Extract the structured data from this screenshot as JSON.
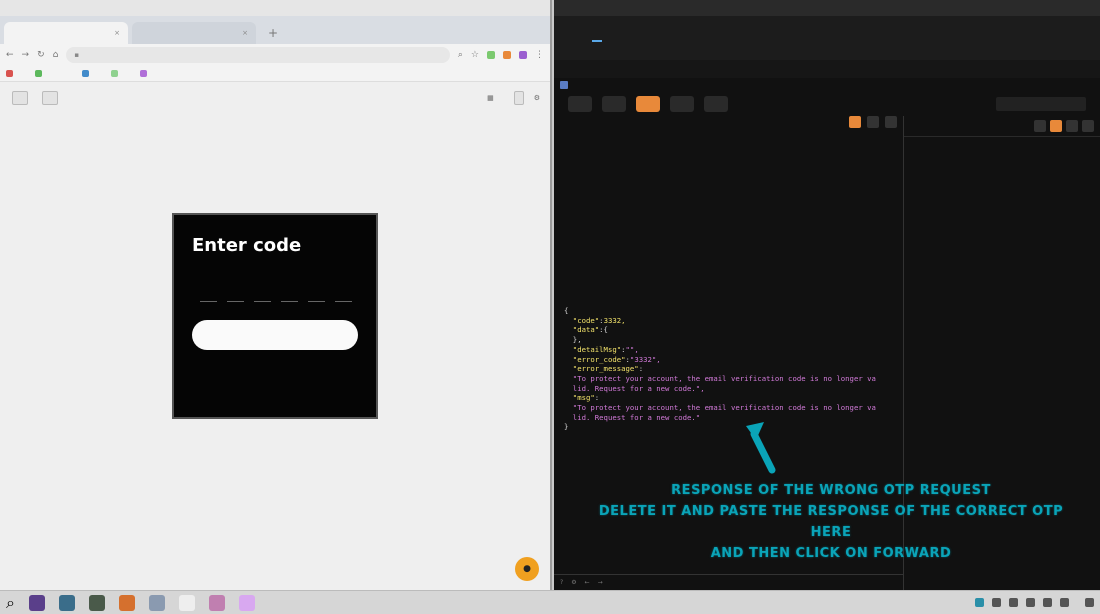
{
  "browser": {
    "window_title": "",
    "tabs": [
      {
        "label": "",
        "active": true
      },
      {
        "label": "",
        "active": false
      }
    ],
    "url": "",
    "bookmarks": [
      "",
      "",
      "",
      "",
      "",
      "",
      ""
    ],
    "toolbar": {
      "left_btn": "",
      "left_btn2": "",
      "right1": "",
      "right2": ""
    }
  },
  "otp_card": {
    "title": "Enter code",
    "subtitle": "",
    "digits": [
      "",
      "",
      "",
      "",
      "",
      ""
    ],
    "next_label": "",
    "footer_text": "",
    "footer_link": ""
  },
  "burp": {
    "window_title": "",
    "menu": [
      "",
      "",
      "",
      "",
      "",
      ""
    ],
    "tabs": [
      "",
      "",
      "",
      "",
      "",
      "",
      "",
      "",
      "",
      "",
      "",
      "",
      "",
      ""
    ],
    "active_tab_index": 2,
    "subtabs": [
      "",
      "",
      "",
      ""
    ],
    "note": "",
    "actions": [
      "",
      "",
      "",
      "",
      ""
    ],
    "editor_tabs": [
      "",
      "",
      "",
      ""
    ],
    "inspector_title": "",
    "inspector_row": "",
    "header_lines": [
      "",
      "",
      "",
      "",
      "",
      "",
      "",
      "",
      "",
      "",
      "",
      "",
      "",
      "",
      "",
      "",
      ""
    ],
    "response": {
      "open": "{",
      "code_key": "\"code\"",
      "code_val": "3332,",
      "data_key": "\"data\"",
      "data_open": ":{",
      "data_close": "},",
      "detail_key": "\"detailMsg\"",
      "detail_val": "\"\",",
      "errcode_key": "\"error_code\"",
      "errcode_val": "\"3332\",",
      "errmsg_key": "\"error_message\"",
      "errmsg_val_1": "\"To protect your account, the email verification code is no longer va",
      "errmsg_val_2": "lid. Request for a new code.\",",
      "msg_key": "\"msg\"",
      "msg_val_1": "\"To protect your account, the email verification code is no longer va",
      "msg_val_2": "lid. Request for a new code.\"",
      "close": "}"
    }
  },
  "annotation": {
    "line1": "RESPONSE OF THE WRONG OTP REQUEST",
    "line2": "DELETE IT AND PASTE THE RESPONSE OF THE CORRECT OTP HERE",
    "line3": "AND THEN CLICK ON FORWARD",
    "color": "#0aa4b8"
  },
  "taskbar": {
    "clock_time": "",
    "clock_date": ""
  }
}
